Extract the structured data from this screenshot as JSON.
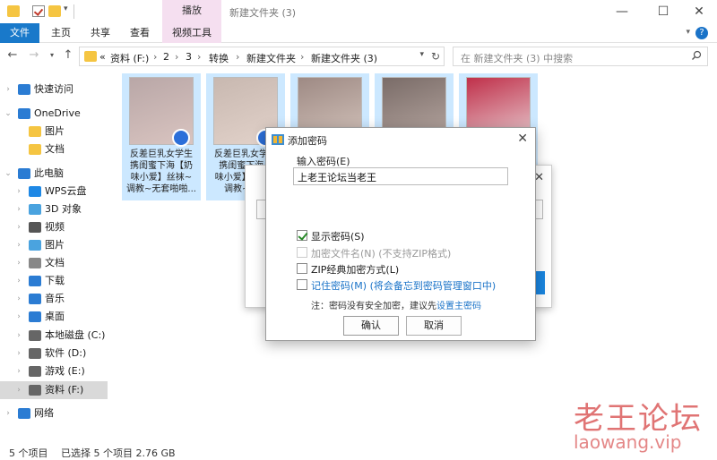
{
  "window": {
    "title": "新建文件夹 (3)",
    "context_tab": "播放",
    "minimize": "—",
    "maximize": "☐",
    "close": "✕"
  },
  "ribbon": {
    "tabs": [
      {
        "label": "文件"
      },
      {
        "label": "主页"
      },
      {
        "label": "共享"
      },
      {
        "label": "查看"
      },
      {
        "label": "视频工具"
      }
    ],
    "help": "?"
  },
  "address": {
    "prefix": "«",
    "crumbs": [
      "资料 (F:)",
      "2",
      "3",
      "转换",
      "新建文件夹",
      "新建文件夹 (3)"
    ],
    "search_placeholder": "在 新建文件夹 (3) 中搜索"
  },
  "nav": {
    "items": [
      {
        "label": "快速访问",
        "icon": "star-icon",
        "color": "#2b7cd3"
      },
      {
        "label": "OneDrive",
        "icon": "cloud-icon",
        "color": "#2b7cd3"
      },
      {
        "label": "图片",
        "icon": "folder-icon",
        "color": "#f5c542"
      },
      {
        "label": "文档",
        "icon": "folder-icon",
        "color": "#f5c542"
      },
      {
        "label": "此电脑",
        "icon": "computer-icon",
        "color": "#2b7cd3"
      },
      {
        "label": "WPS云盘",
        "icon": "cloud-icon",
        "color": "#1e88e5"
      },
      {
        "label": "3D 对象",
        "icon": "cube-icon",
        "color": "#4aa3df"
      },
      {
        "label": "视频",
        "icon": "video-icon",
        "color": "#555555"
      },
      {
        "label": "图片",
        "icon": "picture-icon",
        "color": "#4aa3df"
      },
      {
        "label": "文档",
        "icon": "document-icon",
        "color": "#888888"
      },
      {
        "label": "下载",
        "icon": "download-icon",
        "color": "#2b7cd3"
      },
      {
        "label": "音乐",
        "icon": "music-icon",
        "color": "#2b7cd3"
      },
      {
        "label": "桌面",
        "icon": "desktop-icon",
        "color": "#2b7cd3"
      },
      {
        "label": "本地磁盘 (C:)",
        "icon": "drive-icon",
        "color": "#666666"
      },
      {
        "label": "软件 (D:)",
        "icon": "drive-icon",
        "color": "#666666"
      },
      {
        "label": "游戏 (E:)",
        "icon": "drive-icon",
        "color": "#666666"
      },
      {
        "label": "资料 (F:)",
        "icon": "drive-icon",
        "color": "#666666"
      },
      {
        "label": "网络",
        "icon": "network-icon",
        "color": "#2b7cd3"
      }
    ]
  },
  "files": [
    {
      "label": "反差巨乳女学生\n携闺蜜下海【奶\n味小爱】丝袜~\n调教~无套啪啪..."
    },
    {
      "label": "反差巨乳女学生\n携闺蜜下海...\n味小爱】丝袜~\n调教~无..."
    },
    {
      "label": ""
    },
    {
      "label": ""
    },
    {
      "label": ""
    }
  ],
  "dialog": {
    "title": "添加密码",
    "password_label": "输入密码(E)",
    "password_value": "上老王论坛当老王",
    "options": [
      {
        "label": "显示密码(S)",
        "checked": true,
        "disabled": false,
        "hint": ""
      },
      {
        "label": "加密文件名(N) (不支持ZIP格式)",
        "checked": false,
        "disabled": true,
        "hint": ""
      },
      {
        "label": "ZIP经典加密方式(L)",
        "checked": false,
        "disabled": false,
        "hint": ""
      },
      {
        "label": "记住密码(M)",
        "checked": false,
        "disabled": false,
        "hint": "(将会备忘到密码管理窗口中)"
      }
    ],
    "note_prefix": "注：密码没有安全加密，建议先",
    "note_link": "设置主密码",
    "ok": "确认",
    "cancel": "取消"
  },
  "bg_dialog": {
    "close": "✕"
  },
  "status": {
    "count": "5 个项目",
    "selection": "已选择 5 个项目  2.76 GB"
  },
  "watermark": {
    "text": "老王论坛",
    "url": "laowang.vip"
  }
}
